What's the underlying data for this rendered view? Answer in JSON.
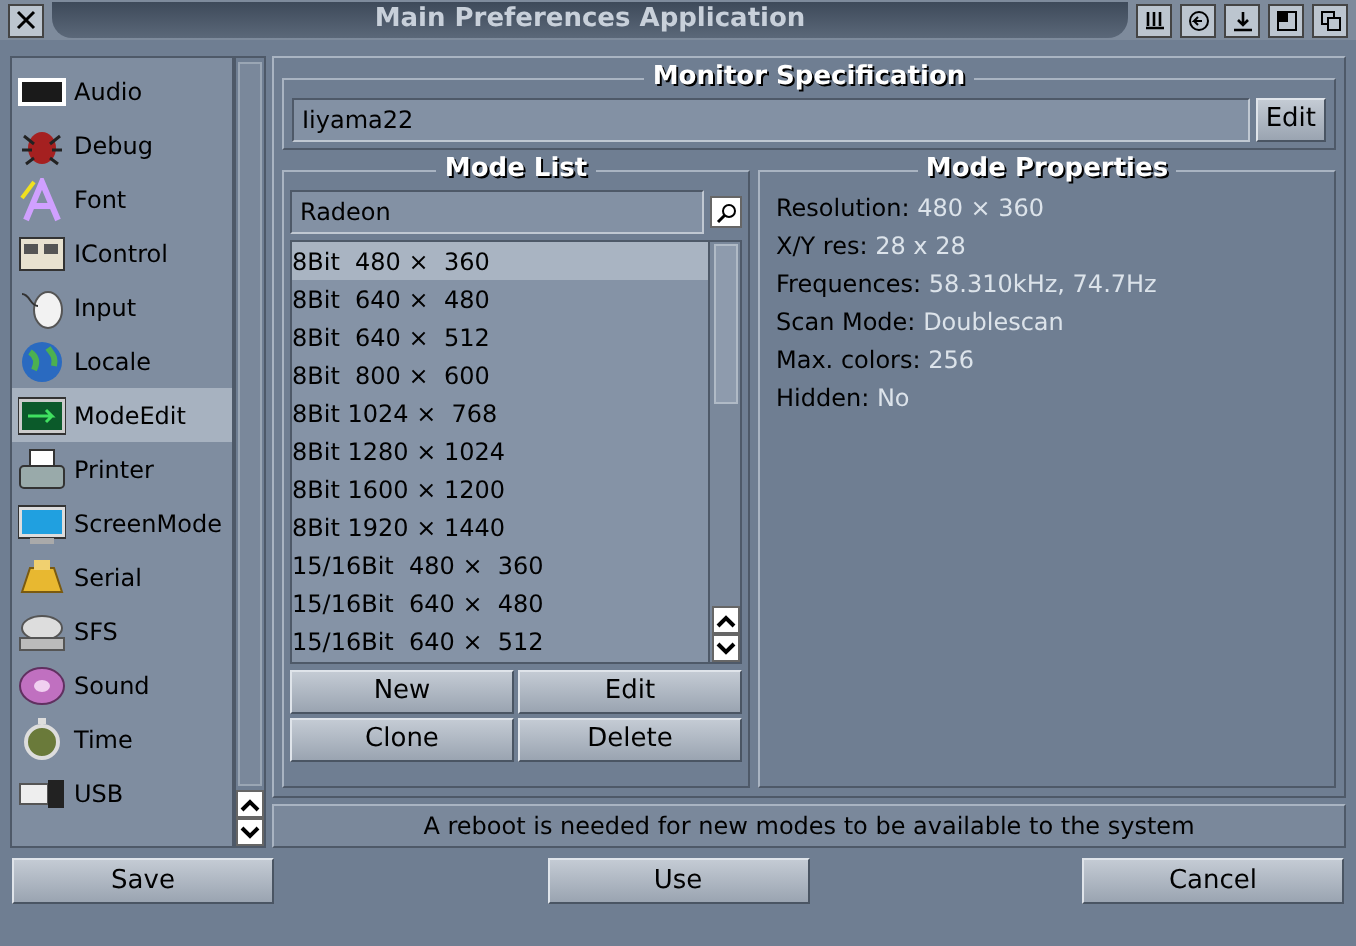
{
  "window": {
    "title": "Main Preferences Application"
  },
  "sidebar": {
    "items": [
      {
        "label": "Audio",
        "selected": false
      },
      {
        "label": "Debug",
        "selected": false
      },
      {
        "label": "Font",
        "selected": false
      },
      {
        "label": "IControl",
        "selected": false
      },
      {
        "label": "Input",
        "selected": false
      },
      {
        "label": "Locale",
        "selected": false
      },
      {
        "label": "ModeEdit",
        "selected": true
      },
      {
        "label": "Printer",
        "selected": false
      },
      {
        "label": "ScreenMode",
        "selected": false
      },
      {
        "label": "Serial",
        "selected": false
      },
      {
        "label": "SFS",
        "selected": false
      },
      {
        "label": "Sound",
        "selected": false
      },
      {
        "label": "Time",
        "selected": false
      },
      {
        "label": "USB",
        "selected": false
      }
    ]
  },
  "monitor_specification": {
    "title": "Monitor Specification",
    "value": "Iiyama22",
    "edit_button": "Edit"
  },
  "mode_list": {
    "title": "Mode List",
    "driver": "Radeon",
    "rows": [
      {
        "text": "8Bit  480 ×  360",
        "selected": true
      },
      {
        "text": "8Bit  640 ×  480",
        "selected": false
      },
      {
        "text": "8Bit  640 ×  512",
        "selected": false
      },
      {
        "text": "8Bit  800 ×  600",
        "selected": false
      },
      {
        "text": "8Bit 1024 ×  768",
        "selected": false
      },
      {
        "text": "8Bit 1280 × 1024",
        "selected": false
      },
      {
        "text": "8Bit 1600 × 1200",
        "selected": false
      },
      {
        "text": "8Bit 1920 × 1440",
        "selected": false
      },
      {
        "text": "15/16Bit  480 ×  360",
        "selected": false
      },
      {
        "text": "15/16Bit  640 ×  480",
        "selected": false
      },
      {
        "text": "15/16Bit  640 ×  512",
        "selected": false
      }
    ],
    "buttons": [
      "New",
      "Edit",
      "Clone",
      "Delete"
    ]
  },
  "mode_properties": {
    "title": "Mode Properties",
    "fields": [
      {
        "label": "Resolution:",
        "value": "480 × 360"
      },
      {
        "label": "X/Y res:",
        "value": "28 x 28"
      },
      {
        "label": "Frequences:",
        "value": "58.310kHz, 74.7Hz"
      },
      {
        "label": "Scan Mode:",
        "value": "Doublescan"
      },
      {
        "label": "Max. colors:",
        "value": "256"
      },
      {
        "label": "Hidden:",
        "value": "No"
      }
    ]
  },
  "status_message": "A reboot is needed for new modes to be available to the system",
  "buttons": [
    "Save",
    "Use",
    "Cancel"
  ]
}
